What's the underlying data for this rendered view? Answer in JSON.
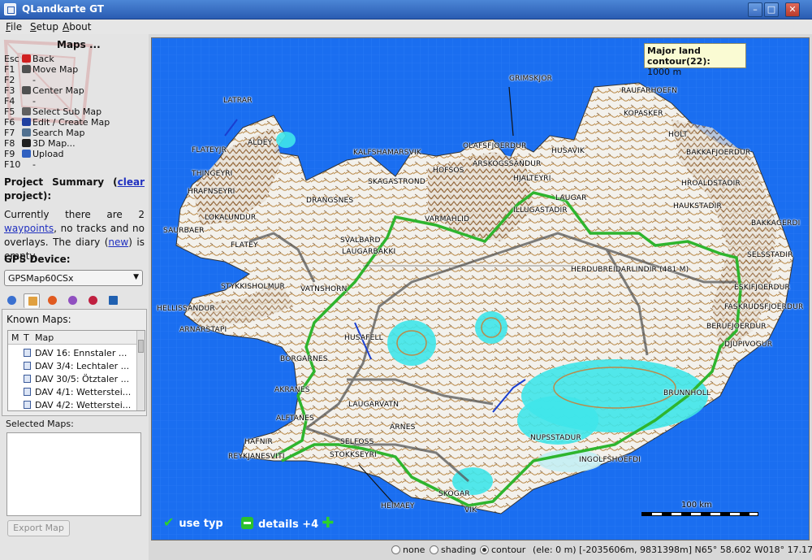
{
  "window": {
    "title": "QLandkarte GT",
    "min": "–",
    "max": "□",
    "close": "✕"
  },
  "menu": [
    "File",
    "Setup",
    "About"
  ],
  "maps_menu": {
    "title": "Maps ...",
    "items": [
      {
        "key": "Esc",
        "label": "Back",
        "icon": "back-arrow-icon",
        "color": "#d02020"
      },
      {
        "key": "F1",
        "label": "Move Map",
        "icon": "move-map-icon",
        "color": "#505050"
      },
      {
        "key": "F2",
        "label": "-",
        "icon": "",
        "color": ""
      },
      {
        "key": "F3",
        "label": "Center Map",
        "icon": "center-map-icon",
        "color": "#505050"
      },
      {
        "key": "F4",
        "label": "-",
        "icon": "",
        "color": ""
      },
      {
        "key": "F5",
        "label": "Select Sub Map",
        "icon": "select-cursor-icon",
        "color": "#606060"
      },
      {
        "key": "F6",
        "label": "Edit / Create Map",
        "icon": "edit-map-icon",
        "color": "#2040a0"
      },
      {
        "key": "F7",
        "label": "Search Map",
        "icon": "search-map-icon",
        "color": "#507090"
      },
      {
        "key": "F8",
        "label": "3D Map...",
        "icon": "3d-map-icon",
        "color": "#202020"
      },
      {
        "key": "F9",
        "label": "Upload",
        "icon": "upload-icon",
        "color": "#3060c0"
      },
      {
        "key": "F10",
        "label": "-",
        "icon": "",
        "color": ""
      }
    ]
  },
  "summary": {
    "title_part": "Project Summary",
    "clear_link": "clear",
    "title_tail": "project):",
    "text_before": "Currently there are 2",
    "waypoints_link": "waypoints",
    "text_mid": ", no tracks and no overlays. The diary (",
    "new_link": "new",
    "text_after": ") is empty."
  },
  "gps": {
    "label": "GPS Device:",
    "selected": "GPSMap60CSx"
  },
  "toolbar_icons": [
    "globe-icon",
    "map-icon",
    "star-icon",
    "track-icon",
    "route-icon",
    "overlay-icon"
  ],
  "known_maps": {
    "label": "Known Maps:",
    "columns": [
      "M",
      "T",
      "Map"
    ],
    "rows": [
      "DAV 16: Ennstaler ...",
      "DAV 3/4: Lechtaler ...",
      "DAV 30/5: Ötztaler ...",
      "DAV 4/1: Wetterstei...",
      "DAV 4/2: Wetterstei..."
    ]
  },
  "selected_maps": {
    "label": "Selected Maps:",
    "export_button": "Export Map"
  },
  "map": {
    "info_title": "Major land contour(22):",
    "info_value": "1000 m",
    "places": [
      "LATRAR",
      "ALDEY",
      "FLATEYJR",
      "THINGEYRI",
      "HRAFNSEYRI",
      "DRANGSNES",
      "LOKALUNDUR",
      "SAURBAER",
      "FLATEY",
      "STYKKISHOLMUR",
      "VATNSHORN",
      "HELLISSANDUR",
      "ARNARSTAPI",
      "KALFSHAMARSVIK",
      "SKAGASTROND",
      "HOFSOS",
      "OLAFSFJOERDUR",
      "ARSKOGSSANDUR",
      "HJALTEYRI",
      "GRIMSKJOR",
      "RAUFARHOEFN",
      "KOPASKER",
      "HOLT",
      "BAKKAFJOERDUR",
      "HUSAVIK",
      "LAUGAR",
      "HROALDSTADIR",
      "HAUKSTADIR",
      "BAKKAGERDI",
      "SELSSTADIR",
      "ESKIFJOERDUR",
      "FASKRUDSFJOERDUR",
      "BERUFJOERDUR",
      "DJUPIVOGUR",
      "SVALBARD",
      "VARMAHLID",
      "ILLUGASTADIR",
      "HERDUBREIDARLINDIR (481 M)",
      "LAUGARBAKKI",
      "HUSAFELL",
      "BORGARNES",
      "AKRANES",
      "LAUGARVATN",
      "ARNES",
      "ALFTANES",
      "HAFNIR",
      "REYKJANESVITI",
      "SELFOSS",
      "STOKKSEYRI",
      "SKOGAR",
      "VIK",
      "HEIMAEY",
      "NUPSSTADUR",
      "INGOLFSHOEFDI",
      "BRUNNHOLL"
    ],
    "use_typ": "use typ",
    "details": "details +4",
    "scale": "100 km"
  },
  "status": {
    "options": [
      "none",
      "shading",
      "contour"
    ],
    "selected": "contour",
    "coords": "(ele: 0 m) [-2035606m, 9831398m] N65° 58.602 W018° 17.170"
  }
}
